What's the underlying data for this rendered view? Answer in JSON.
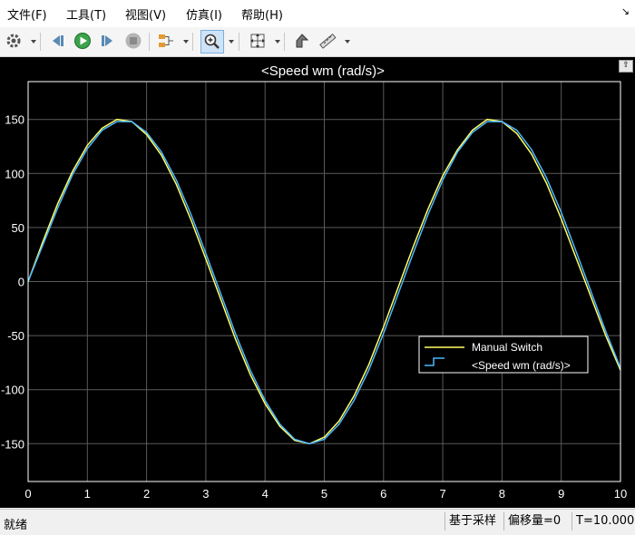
{
  "menu": {
    "items": [
      {
        "label": "文件(F)"
      },
      {
        "label": "工具(T)"
      },
      {
        "label": "视图(V)"
      },
      {
        "label": "仿真(I)"
      },
      {
        "label": "帮助(H)"
      }
    ]
  },
  "toolbar": {
    "icons": [
      "gear-icon",
      "step-back-icon",
      "run-icon",
      "step-forward-icon",
      "stop-icon",
      "signal-select-icon",
      "zoom-in-icon",
      "fit-view-icon",
      "cursor-measure-icon",
      "ruler-icon"
    ]
  },
  "status": {
    "ready": "就绪",
    "sample_mode": "基于采样",
    "offset": "偏移量=0",
    "time": "T=10.000"
  },
  "colors": {
    "background": "#000000",
    "axes_text": "#ffffff",
    "grid": "#5a5a5a",
    "series1": "#ffff66",
    "series2": "#4db8ff"
  },
  "chart_data": {
    "type": "line",
    "title": "<Speed wm (rad/s)>",
    "xlabel": "",
    "ylabel": "",
    "xlim": [
      0,
      10
    ],
    "ylim": [
      -185,
      185
    ],
    "xticks": [
      0,
      1,
      2,
      3,
      4,
      5,
      6,
      7,
      8,
      9,
      10
    ],
    "yticks": [
      -150,
      -100,
      -50,
      0,
      50,
      100,
      150
    ],
    "grid": true,
    "legend_position": "center-right",
    "series": [
      {
        "name": "Manual Switch",
        "color": "#ffff66",
        "x": [
          0,
          0.25,
          0.5,
          0.75,
          1,
          1.25,
          1.5,
          1.75,
          2,
          2.25,
          2.5,
          2.75,
          3,
          3.25,
          3.5,
          3.75,
          4,
          4.25,
          4.5,
          4.75,
          5,
          5.25,
          5.5,
          5.75,
          6,
          6.25,
          6.5,
          6.75,
          7,
          7.25,
          7.5,
          7.75,
          8,
          8.25,
          8.5,
          8.75,
          9,
          9.25,
          9.5,
          9.75,
          10
        ],
        "y": [
          0,
          37,
          72,
          102,
          126,
          142,
          150,
          148,
          136,
          117,
          90,
          57,
          21,
          -16,
          -53,
          -86,
          -113,
          -134,
          -147,
          -150,
          -144,
          -129,
          -106,
          -77,
          -42,
          -5,
          32,
          67,
          98,
          122,
          140,
          150,
          148,
          137,
          118,
          91,
          58,
          22,
          -14,
          -50,
          -82
        ]
      },
      {
        "name": "<Speed wm (rad/s)>",
        "color": "#4db8ff",
        "x": [
          0,
          0.25,
          0.5,
          0.75,
          1,
          1.25,
          1.5,
          1.75,
          2,
          2.25,
          2.5,
          2.75,
          3,
          3.25,
          3.5,
          3.75,
          4,
          4.25,
          4.5,
          4.75,
          5,
          5.25,
          5.5,
          5.75,
          6,
          6.25,
          6.5,
          6.75,
          7,
          7.25,
          7.5,
          7.75,
          8,
          8.25,
          8.5,
          8.75,
          9,
          9.25,
          9.5,
          9.75,
          10
        ],
        "y": [
          0,
          34,
          68,
          99,
          123,
          140,
          148,
          148,
          138,
          120,
          94,
          62,
          26,
          -11,
          -48,
          -82,
          -110,
          -132,
          -146,
          -150,
          -146,
          -132,
          -110,
          -82,
          -48,
          -11,
          26,
          62,
          94,
          120,
          138,
          148,
          148,
          140,
          122,
          96,
          64,
          28,
          -9,
          -46,
          -80
        ]
      }
    ]
  }
}
